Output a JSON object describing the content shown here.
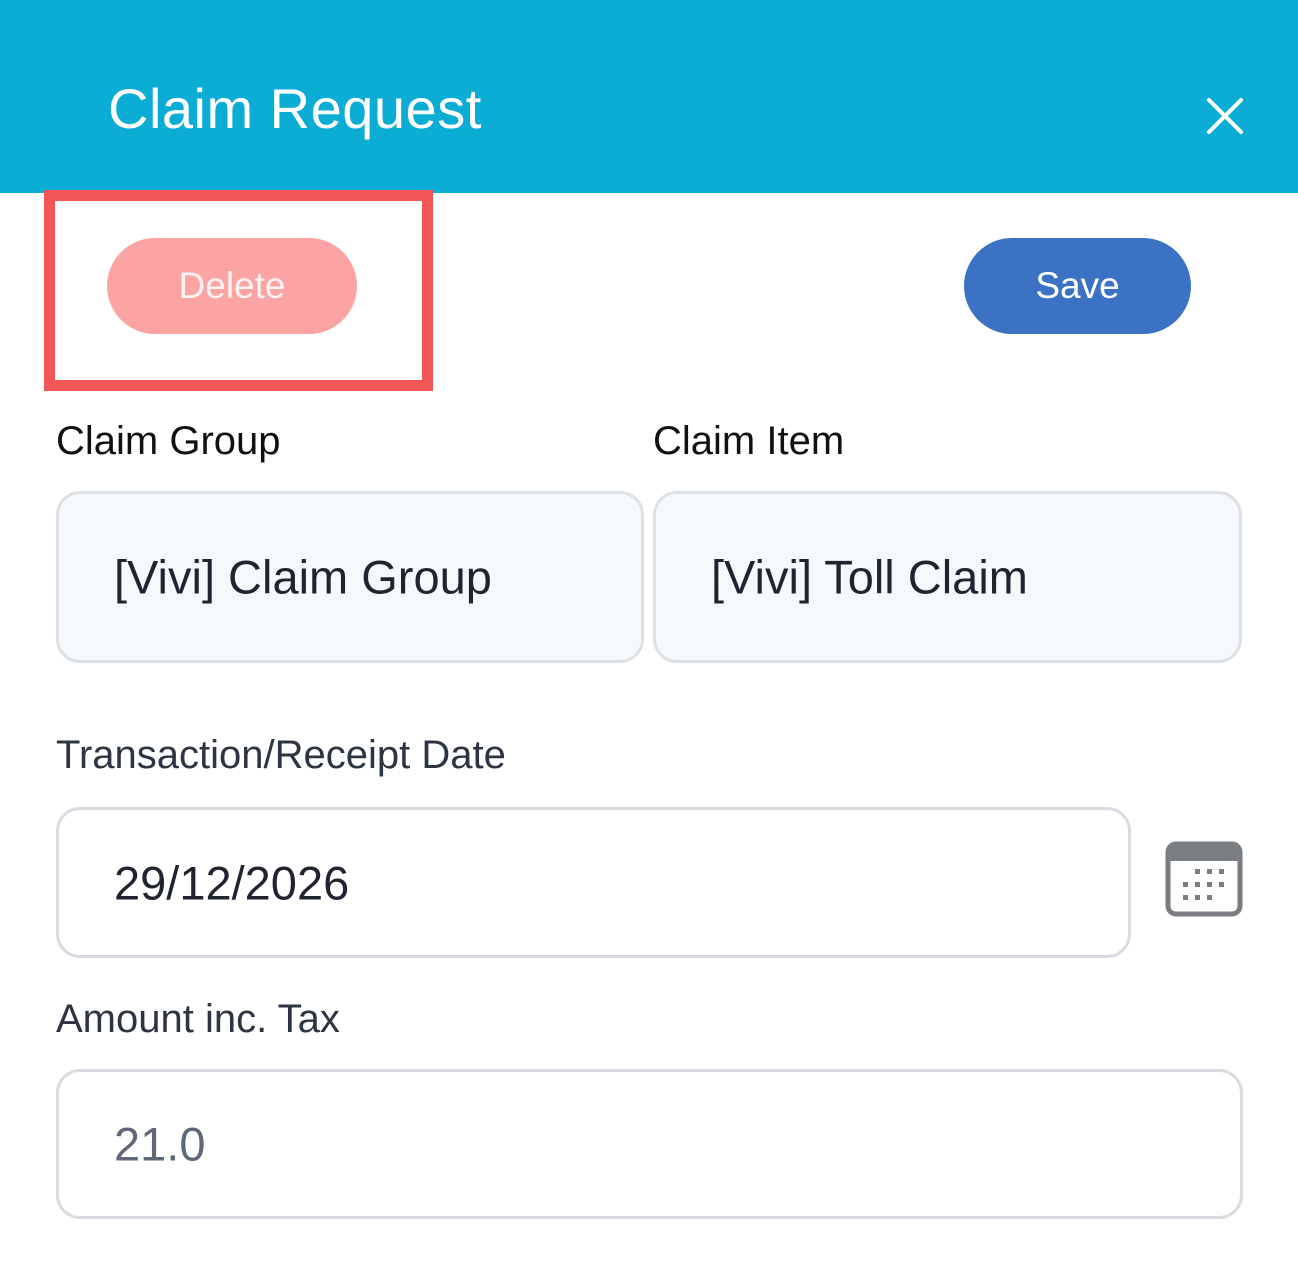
{
  "header": {
    "title": "Claim Request",
    "background_color": "#0cadd4",
    "close_icon": "close-icon"
  },
  "actions": {
    "delete_label": "Delete",
    "save_label": "Save",
    "delete_color": "#fca3a3",
    "save_color": "#3b72c4",
    "highlight_color": "#f25656"
  },
  "form": {
    "claim_group": {
      "label": "Claim Group",
      "value": "[Vivi] Claim Group"
    },
    "claim_item": {
      "label": "Claim Item",
      "value": "[Vivi] Toll Claim"
    },
    "transaction_date": {
      "label": "Transaction/Receipt Date",
      "value": "29/12/2026",
      "icon": "calendar-icon"
    },
    "amount": {
      "label": "Amount inc. Tax",
      "value": "21.0"
    }
  }
}
